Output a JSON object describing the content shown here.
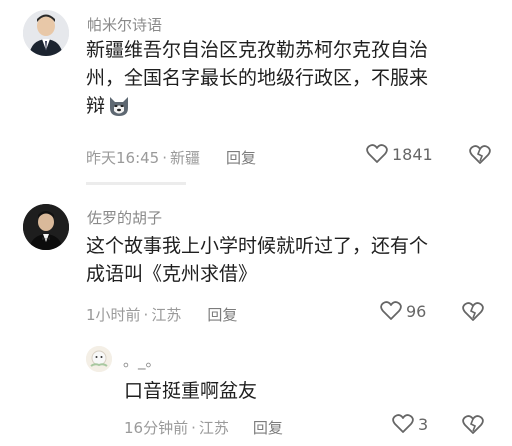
{
  "comments": [
    {
      "username": "帕米尔诗语",
      "text_lines": [
        "新疆维吾尔自治区克孜勒苏柯尔克孜自治",
        "州，全国名字最长的地级行政区，不服来",
        "辩"
      ],
      "time": "昨天16:45",
      "location": "新疆",
      "reply_label": "回复",
      "like_count": "1841",
      "emoji_icon": "husky-dog-emoji"
    },
    {
      "username": "佐罗的胡子",
      "text_lines": [
        "这个故事我上小学时候就听过了，还有个",
        "成语叫《克州求借》"
      ],
      "time": "1小时前",
      "location": "江苏",
      "reply_label": "回复",
      "like_count": "96"
    },
    {
      "username": "。_。",
      "text_lines": [
        "口音挺重啊盆友"
      ],
      "time": "16分钟前",
      "location": "江苏",
      "reply_label": "回复",
      "like_count": "3"
    }
  ],
  "separator": "·",
  "colors": {
    "text": "#1f1f1f",
    "meta": "#9a9a9a",
    "name": "#8a8a8a",
    "divider": "#ececec"
  }
}
